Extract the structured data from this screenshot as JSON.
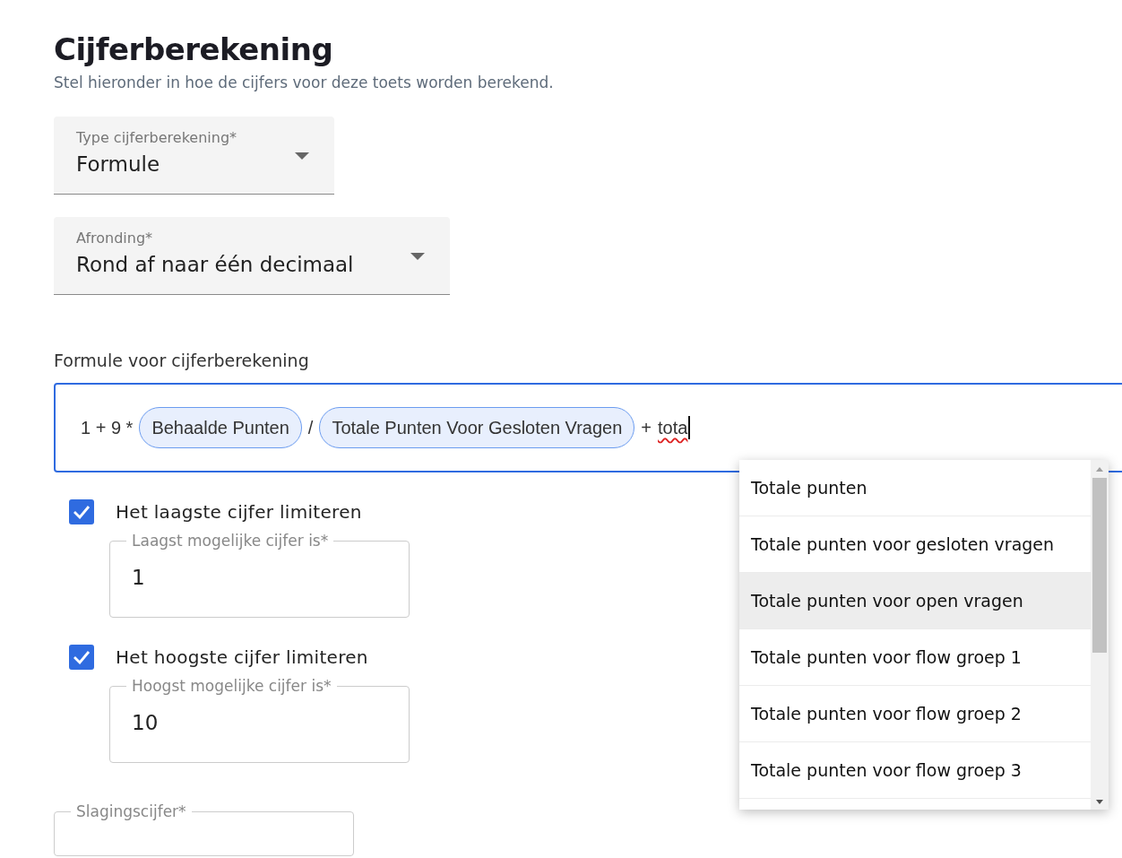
{
  "title": "Cijferberekening",
  "subtitle": "Stel hieronder in hoe de cijfers voor deze toets worden berekend.",
  "selects": [
    {
      "label": "Type cijferberekening*",
      "value": "Formule"
    },
    {
      "label": "Afronding*",
      "value": "Rond af naar één decimaal"
    }
  ],
  "formula": {
    "label": "Formule voor cijferberekening",
    "tokens": [
      {
        "kind": "text",
        "text": "1 + 9 *"
      },
      {
        "kind": "chip",
        "text": "Behaalde Punten"
      },
      {
        "kind": "text",
        "text": "/"
      },
      {
        "kind": "chip",
        "text": "Totale Punten Voor Gesloten Vragen"
      },
      {
        "kind": "text",
        "text": "+"
      },
      {
        "kind": "typed",
        "text": "tota"
      }
    ]
  },
  "limits": [
    {
      "label": "Het laagste cijfer limiteren",
      "checked": true,
      "field_label": "Laagst mogelijke cijfer is*",
      "value": "1"
    },
    {
      "label": "Het hoogste cijfer limiteren",
      "checked": true,
      "field_label": "Hoogst mogelijke cijfer is*",
      "value": "10"
    }
  ],
  "pass_field": {
    "label": "Slagingscijfer*"
  },
  "suggestions": [
    {
      "text": "Totale punten",
      "selected": false
    },
    {
      "text": "Totale punten voor gesloten vragen",
      "selected": false
    },
    {
      "text": "Totale punten voor open vragen",
      "selected": true
    },
    {
      "text": "Totale punten voor flow groep 1",
      "selected": false
    },
    {
      "text": "Totale punten voor flow groep 2",
      "selected": false
    },
    {
      "text": "Totale punten voor flow groep 3",
      "selected": false
    }
  ]
}
